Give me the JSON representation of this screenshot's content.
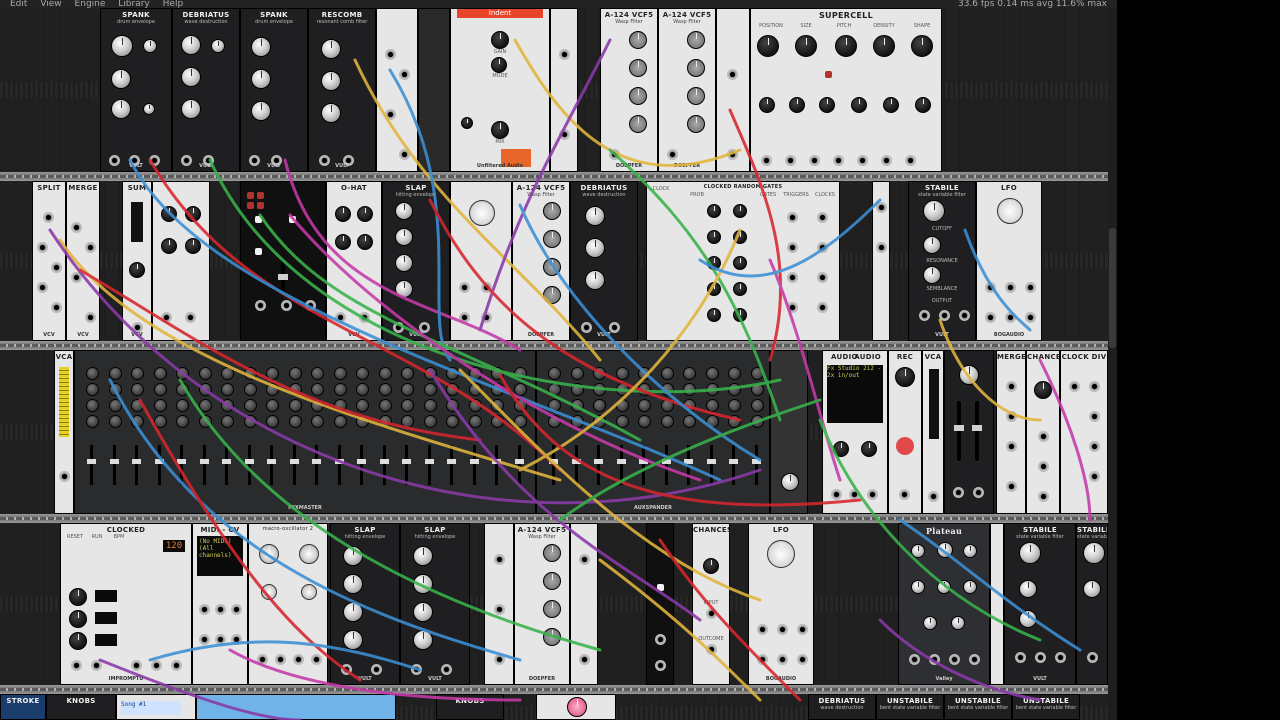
{
  "menubar": {
    "items": [
      "Edit",
      "View",
      "Engine",
      "Library",
      "Help"
    ],
    "stats": "33.6 fps  0.14 ms avg  11.6% max"
  },
  "colors": {
    "cable_red": "#d8262e",
    "cable_blue": "#3b8fd4",
    "cable_green": "#38b24a",
    "cable_yellow": "#e1b53c",
    "cable_purple": "#8a3aa8",
    "cable_magenta": "#c63aa8",
    "rail": "#8c8c8c",
    "panel_dark": "#1f1f22",
    "panel_light": "#e6e6e6"
  },
  "modules": {
    "spank1": {
      "title": "SPANK",
      "subtitle": "drum envelope",
      "brand": "VULT"
    },
    "debriatus1": {
      "title": "DEBRIATUS",
      "subtitle": "wave destruction",
      "brand": "VULT"
    },
    "spank2": {
      "title": "SPANK",
      "subtitle": "drum envelope",
      "brand": "VULT"
    },
    "rescomb": {
      "title": "RESCOMB",
      "subtitle": "resonant comb filter",
      "brand": "VULT"
    },
    "indent": {
      "tag": "Indent",
      "labels": [
        "GAIN",
        "MODE",
        "MIX"
      ],
      "brand": "Unfiltered Audio"
    },
    "wasp1": {
      "title": "A-124 VCF5",
      "subtitle": "Wasp Filter",
      "brand": "DOEPFER"
    },
    "wasp2": {
      "title": "A-124 VCF5",
      "subtitle": "Wasp Filter",
      "brand": "DOEPFER"
    },
    "supercell": {
      "title": "SUPERCELL",
      "knob_labels": [
        "POSITION",
        "SIZE",
        "PITCH",
        "DENSITY",
        "SHAPE"
      ]
    },
    "split": {
      "title": "SPLIT",
      "brand": "VCV"
    },
    "merge": {
      "title": "MERGE",
      "brand": "VCV"
    },
    "sum": {
      "title": "SUM",
      "brand": "VCV"
    },
    "ohat": {
      "title": "O-HAT",
      "brand": "VCV"
    },
    "slap1": {
      "title": "SLAP",
      "subtitle": "hitting envelope",
      "brand": "VULT"
    },
    "wasp3": {
      "title": "A-124 VCF5",
      "subtitle": "Wasp Filter",
      "brand": "DOEPFER"
    },
    "debriatus2": {
      "title": "DEBRIATUS",
      "subtitle": "wave destruction",
      "brand": "VULT"
    },
    "gates": {
      "title": "CLOCKED RANDOM GATES",
      "columns": [
        "CLOCK",
        "PROB",
        "GATES",
        "TRIGGERS",
        "CLOCKS"
      ]
    },
    "stabile1": {
      "title": "STABILE",
      "subtitle": "state variable filter",
      "labels": [
        "CUTOFF",
        "RESONANCE",
        "SEMBLANCE",
        "OUTPUT"
      ],
      "brand": "VULT"
    },
    "lfo1": {
      "title": "LFO",
      "brand": "BOGAUDIO"
    },
    "vca1": {
      "title": "VCA"
    },
    "mixmaster": {
      "brand": "MIXMASTER"
    },
    "auxspander": {
      "brand": "AUXSPANDER"
    },
    "audio": {
      "title": "AUDIO",
      "title2": "AUDIO",
      "device": "Fx Studio 2i2 - 2x in/out"
    },
    "rec": {
      "title": "REC"
    },
    "vca2": {
      "title": "VCA"
    },
    "merge2": {
      "title": "MERGE"
    },
    "chances": {
      "title": "CHANCES"
    },
    "clockdiv": {
      "title": "CLOCK DIV"
    },
    "clocked": {
      "title": "CLOCKED",
      "labels": [
        "RESET",
        "RUN",
        "BPM"
      ],
      "bpm": "120",
      "brand": "IMPROMPTU"
    },
    "midicv": {
      "title": "MIDI - CV",
      "lines": [
        "(No MIDI)",
        "(All channels)"
      ]
    },
    "macro": {
      "title": "macro-oscillator 2"
    },
    "slap2": {
      "title": "SLAP",
      "subtitle": "hitting envelope",
      "brand": "VULT"
    },
    "slap3": {
      "title": "SLAP",
      "subtitle": "hitting envelope",
      "brand": "VULT"
    },
    "wasp4": {
      "title": "A-124 VCF5",
      "subtitle": "Wasp Filter",
      "brand": "DOEPFER"
    },
    "chances2": {
      "title": "CHANCES",
      "labels": [
        "INPUT",
        "OUTCOME"
      ]
    },
    "lfo2": {
      "title": "LFO",
      "brand": "BOGAUDIO"
    },
    "plateau": {
      "title": "Plateau",
      "brand": "Valley"
    },
    "stabile2": {
      "title": "STABILE",
      "subtitle": "state variable filter",
      "brand": "VULT"
    },
    "stabile3": {
      "title": "STABILE",
      "subtitle": "state variable filter",
      "brand": "VULT"
    },
    "strokes": {
      "title": "STROKE"
    },
    "knobs1": {
      "title": "KNOBS"
    },
    "song": {
      "text": "Song #1"
    },
    "knobs2": {
      "title": "KNOBS"
    },
    "debriatus3": {
      "title": "DEBRIATUS",
      "subtitle": "wave destruction"
    },
    "unstabile1": {
      "title": "UNSTABILE",
      "subtitle": "bent state variable filter"
    },
    "unstabile2": {
      "title": "UNSTABILE",
      "subtitle": "bent state variable filter"
    },
    "unstabile3": {
      "title": "UNSTABILE",
      "subtitle": "bent state variable filter"
    }
  }
}
